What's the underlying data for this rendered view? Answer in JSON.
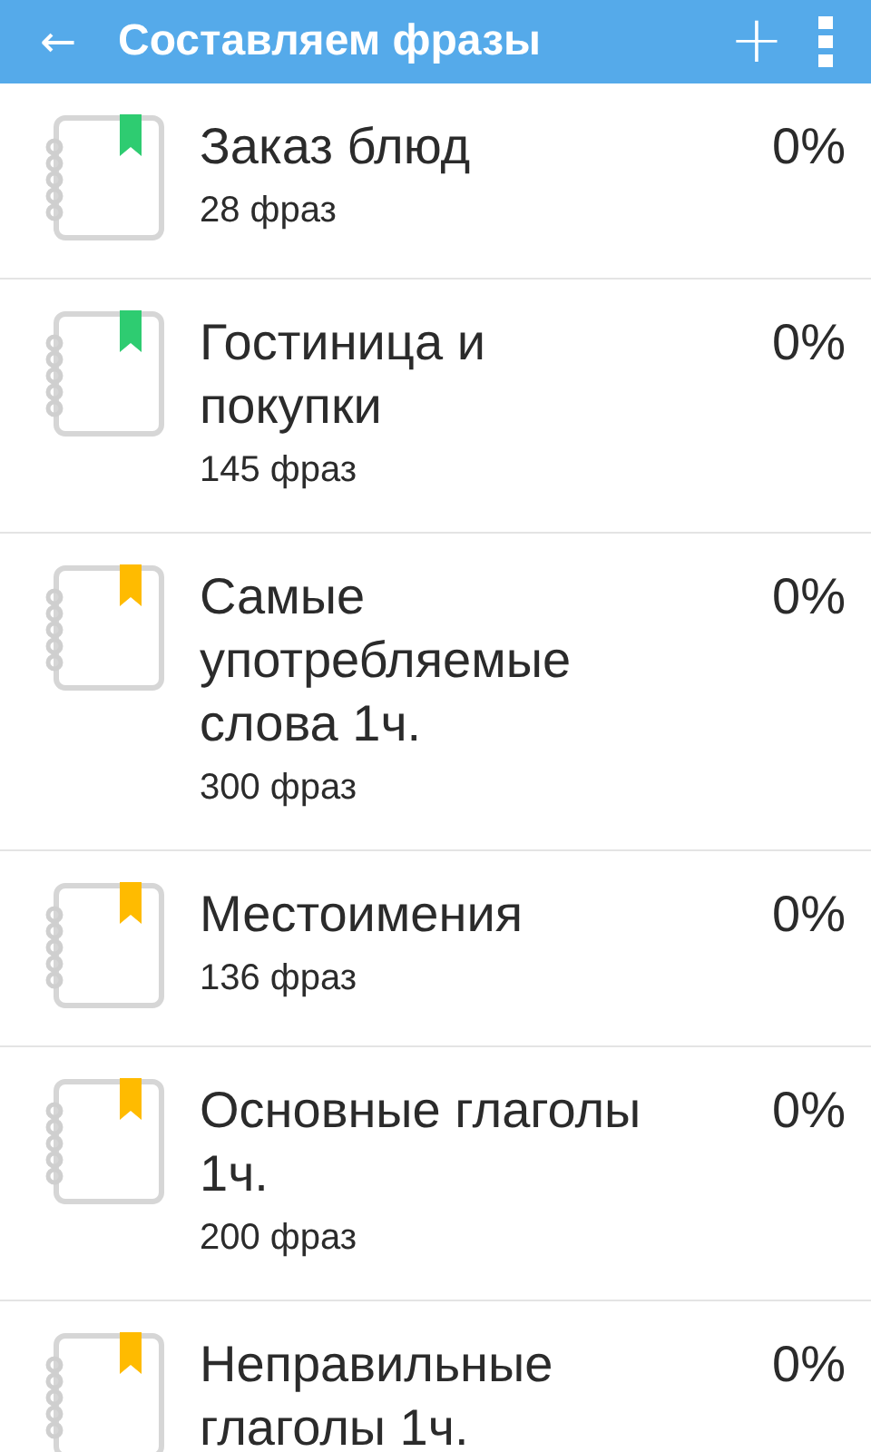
{
  "app_bar": {
    "back": "←",
    "title": "Составляем фразы",
    "add": "+"
  },
  "items": [
    {
      "title": "Заказ блюд",
      "count": "28 фраз",
      "progress": "0%",
      "color": "#2ecc71"
    },
    {
      "title": "Гостиница и\nпокупки",
      "count": "145 фраз",
      "progress": "0%",
      "color": "#2ecc71"
    },
    {
      "title": "Самые\nупотребляемые\nслова 1ч.",
      "count": "300 фраз",
      "progress": "0%",
      "color": "#ffbb00"
    },
    {
      "title": "Местоимения",
      "count": "136 фраз",
      "progress": "0%",
      "color": "#ffbb00"
    },
    {
      "title": "Основные глаголы\n1ч.",
      "count": "200 фраз",
      "progress": "0%",
      "color": "#ffbb00"
    },
    {
      "title": "Неправильные\nглаголы 1ч.",
      "progress": "0%",
      "color": "#ffbb00"
    }
  ]
}
